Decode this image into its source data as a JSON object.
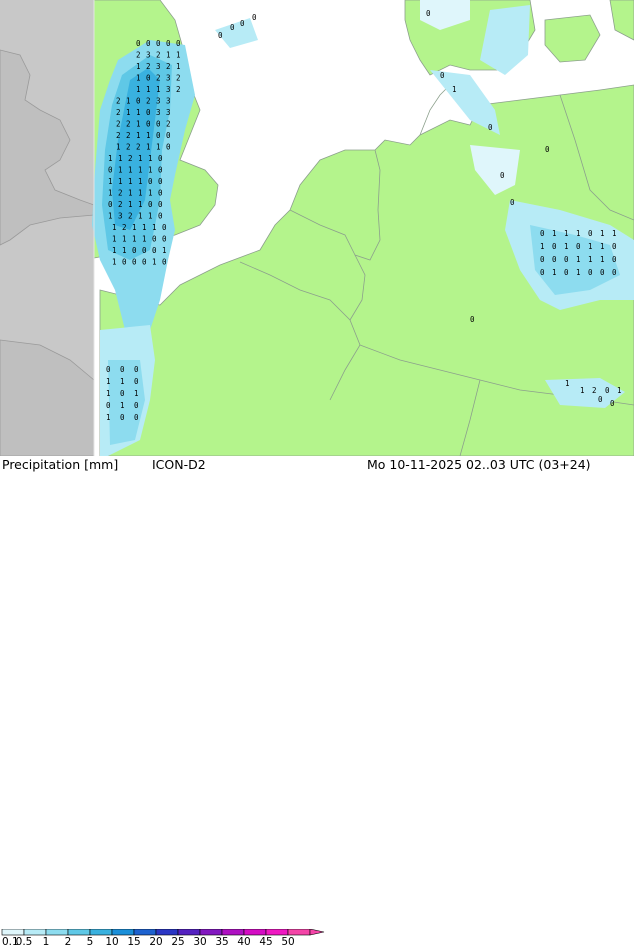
{
  "footer": {
    "title": "Precipitation [mm]",
    "model": "ICON-D2",
    "valid_time": "Mo 10-11-2025 02..03 UTC (03+24)"
  },
  "legend": {
    "labels": [
      "0.1",
      "0.5",
      "1",
      "2",
      "5",
      "10",
      "15",
      "20",
      "25",
      "30",
      "35",
      "40",
      "45",
      "50"
    ],
    "colors": [
      "#dff6fb",
      "#b7ebf6",
      "#8ddcef",
      "#5fc8e6",
      "#39b1df",
      "#1a8fd9",
      "#1d62cf",
      "#2a36c4",
      "#5421c0",
      "#8218c0",
      "#ae10c2",
      "#d40cc4",
      "#ef18c2",
      "#f445a8"
    ]
  },
  "colors": {
    "land_model": "#b4f48c",
    "land_outside": "#c8c8c8",
    "sea": "#ffffff",
    "border": "#8ca08c"
  },
  "precip_labels": {
    "uk_band": [
      "0",
      "0",
      "0",
      "0",
      "0",
      "2",
      "3",
      "2",
      "1",
      "1",
      "1",
      "2",
      "3",
      "2",
      "1",
      "1",
      "0",
      "2",
      "3",
      "2",
      "1",
      "1",
      "1",
      "3",
      "2",
      "2",
      "1",
      "0",
      "2",
      "3",
      "3",
      "2",
      "1",
      "1",
      "0",
      "3",
      "3",
      "2",
      "2",
      "1",
      "0",
      "0",
      "2",
      "2",
      "2",
      "1",
      "1",
      "0",
      "0",
      "1",
      "2",
      "2",
      "1",
      "1",
      "0",
      "1",
      "1",
      "2",
      "1",
      "1",
      "0",
      "0",
      "1",
      "1",
      "1",
      "1",
      "0",
      "1",
      "1",
      "1",
      "1",
      "0",
      "0",
      "1",
      "2",
      "1",
      "1",
      "1",
      "0",
      "0",
      "2",
      "1",
      "1",
      "0",
      "0",
      "1",
      "3",
      "2",
      "1",
      "1",
      "0",
      "1",
      "2",
      "1",
      "1",
      "1",
      "0",
      "1",
      "1",
      "1",
      "1",
      "0",
      "0",
      "1",
      "1",
      "0",
      "0",
      "0",
      "1",
      "1",
      "0",
      "0",
      "0",
      "1",
      "0"
    ],
    "french_coast": [
      "0",
      "0",
      "0",
      "1",
      "1",
      "0",
      "1",
      "0",
      "1",
      "0",
      "1",
      "0",
      "1",
      "0",
      "0"
    ],
    "dutch_east": [
      "0",
      "1",
      "1",
      "1",
      "0",
      "1",
      "1",
      "1",
      "0",
      "1",
      "0",
      "1",
      "1",
      "0",
      "0",
      "0",
      "0",
      "1",
      "1",
      "1",
      "0",
      "0",
      "1",
      "0",
      "1",
      "0",
      "0",
      "0"
    ],
    "north_sea_isles": [
      "0",
      "0",
      "0",
      "0",
      "0",
      "0",
      "1",
      "0",
      "0",
      "0",
      "0"
    ],
    "south_east": [
      "1",
      "1",
      "2",
      "0",
      "1",
      "0",
      "0",
      "0"
    ]
  }
}
